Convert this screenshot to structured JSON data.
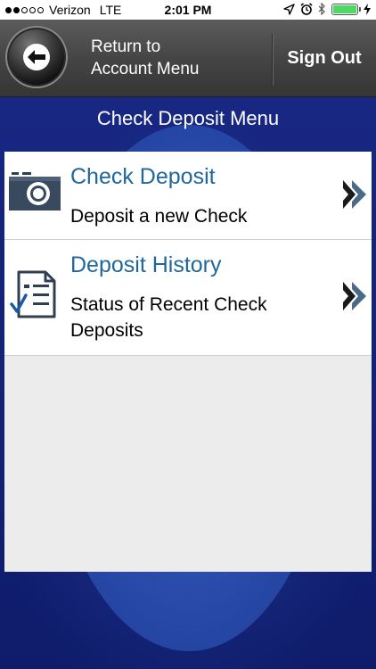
{
  "status_bar": {
    "carrier": "Verizon",
    "network": "LTE",
    "time": "2:01 PM"
  },
  "header": {
    "back_label_line1": "Return to",
    "back_label_line2": "Account Menu",
    "signout_label": "Sign Out"
  },
  "menu": {
    "title": "Check Deposit Menu",
    "items": [
      {
        "title": "Check Deposit",
        "description": "Deposit a new Check",
        "icon": "camera-icon"
      },
      {
        "title": "Deposit History",
        "description": "Status of Recent Check Deposits",
        "icon": "document-check-icon"
      }
    ]
  },
  "colors": {
    "accent": "#20689c",
    "background": "#1b2a86",
    "header": "#454545",
    "battery": "#4cd964"
  }
}
